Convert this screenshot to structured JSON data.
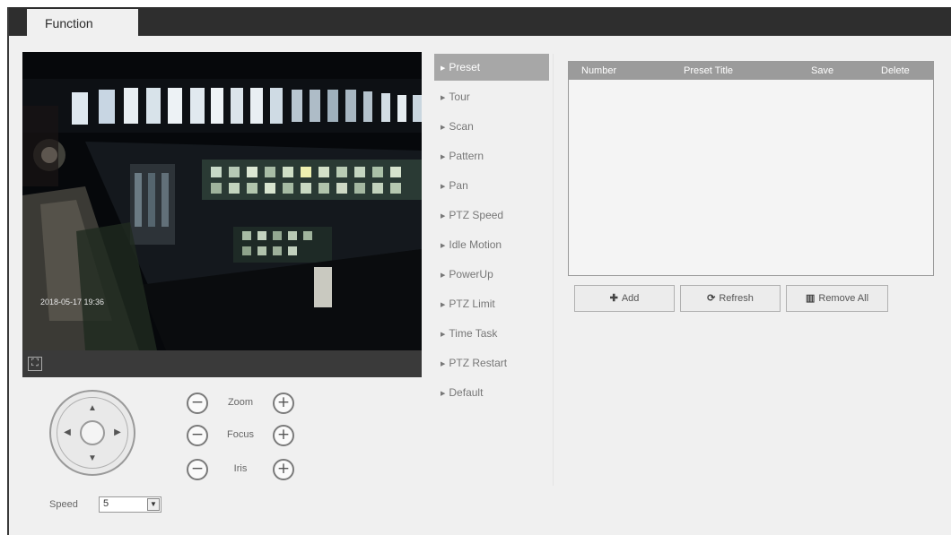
{
  "tab": {
    "label": "Function"
  },
  "ptz": {
    "zoom_label": "Zoom",
    "focus_label": "Focus",
    "iris_label": "Iris",
    "minus_symbol": "−",
    "plus_symbol": "+",
    "speed_label": "Speed",
    "speed_value": "5"
  },
  "menu": {
    "items": [
      {
        "label": "Preset"
      },
      {
        "label": "Tour"
      },
      {
        "label": "Scan"
      },
      {
        "label": "Pattern"
      },
      {
        "label": "Pan"
      },
      {
        "label": "PTZ Speed"
      },
      {
        "label": "Idle Motion"
      },
      {
        "label": "PowerUp"
      },
      {
        "label": "PTZ Limit"
      },
      {
        "label": "Time Task"
      },
      {
        "label": "PTZ Restart"
      },
      {
        "label": "Default"
      }
    ]
  },
  "table": {
    "headers": [
      "Number",
      "Preset Title",
      "Save",
      "Delete"
    ]
  },
  "buttons": {
    "add": "Add",
    "refresh": "Refresh",
    "remove_all": "Remove All"
  },
  "icons": {
    "fullscreen": "fullscreen-icon",
    "add": "plus-icon",
    "refresh": "refresh-icon",
    "remove_all": "trash-icon"
  },
  "colors": {
    "tabbar": "#2e2e2e",
    "menu_active": "#a7a7a7",
    "table_header": "#9b9b9b"
  }
}
